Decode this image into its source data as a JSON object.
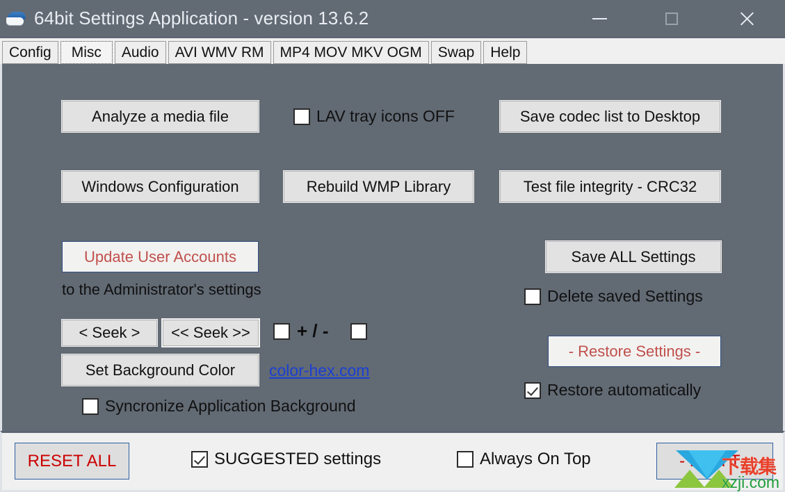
{
  "window": {
    "title": "64bit Settings Application - version 13.6.2",
    "icon": "app-cap-icon",
    "minimize_label": "—",
    "maximize_label": "□",
    "close_label": "✕"
  },
  "tabs": [
    {
      "label": "Config",
      "selected": false
    },
    {
      "label": "Misc",
      "selected": true
    },
    {
      "label": "Audio",
      "selected": false
    },
    {
      "label": "AVI WMV RM",
      "selected": false
    },
    {
      "label": "MP4 MOV MKV OGM",
      "selected": false
    },
    {
      "label": "Swap",
      "selected": false
    },
    {
      "label": "Help",
      "selected": false
    }
  ],
  "main": {
    "analyze_button": "Analyze a media file",
    "lav_tray_checkbox": {
      "label": "LAV tray icons OFF",
      "checked": false
    },
    "save_codec_button": "Save codec list to Desktop",
    "windows_config_button": "Windows Configuration",
    "rebuild_wmp_button": "Rebuild WMP Library",
    "test_integrity_button": "Test file integrity - CRC32",
    "update_accounts_button": "Update User Accounts",
    "update_accounts_note": "to the Administrator's settings",
    "seek_single_button": "<  Seek  >",
    "seek_double_button": "<< Seek >>",
    "plus_minus_label": "+ / -",
    "plus_checkbox": {
      "checked": false
    },
    "minus_checkbox": {
      "checked": false
    },
    "set_bg_color_button": "Set Background Color",
    "color_hex_link": "color-hex.com",
    "syncronize_checkbox": {
      "label": "Syncronize Application Background",
      "checked": false
    },
    "save_all_button": "Save ALL Settings",
    "delete_saved_checkbox": {
      "label": "Delete saved Settings",
      "checked": false
    },
    "restore_settings_button": "- Restore Settings -",
    "restore_auto_checkbox": {
      "label": "Restore automatically",
      "checked": true
    }
  },
  "bottom": {
    "reset_all_button": "RESET ALL",
    "suggested_checkbox": {
      "label": "SUGGESTED settings",
      "checked": true
    },
    "always_on_top_checkbox": {
      "label": "Always On Top",
      "checked": false
    },
    "exit_button": "-  E X I T  -"
  },
  "watermark": {
    "cn_text": "下载集",
    "url_text": "xzji.com"
  },
  "colors": {
    "window_background": "#626a74",
    "chrome_light": "#f0f0f0",
    "button_face": "#e2e2e2",
    "accent_red": "#c0504d",
    "reset_red": "#cc0000",
    "link_blue": "#1a3fd4",
    "accent_border_blue": "#2f4f7f"
  }
}
